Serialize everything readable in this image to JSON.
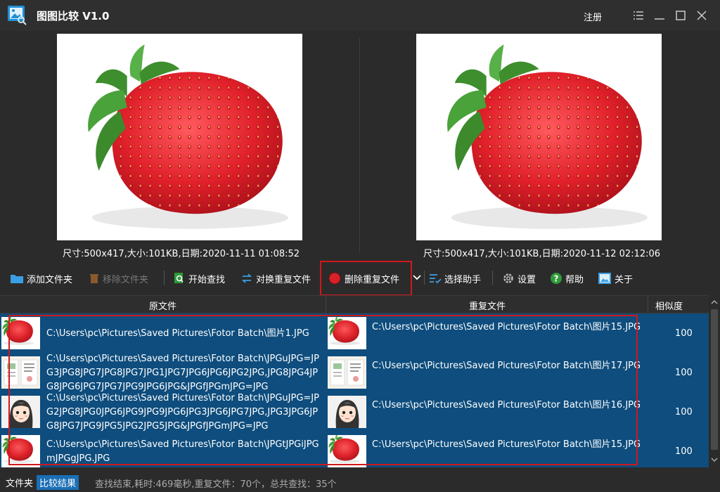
{
  "app": {
    "title": "图图比较 V1.0",
    "register_label": "注册"
  },
  "preview": {
    "left_caption": "尺寸:500x417,大小:101KB,日期:2020-11-11 01:08:52",
    "right_caption": "尺寸:500x417,大小:101KB,日期:2020-11-12 02:12:06"
  },
  "toolbar": {
    "add_folder": "添加文件夹",
    "remove_folder": "移除文件夹",
    "start_search": "开始查找",
    "swap_duplicates": "对换重复文件",
    "delete_duplicates": "删除重复文件",
    "select_helper": "选择助手",
    "settings": "设置",
    "help": "帮助",
    "about": "关于"
  },
  "table": {
    "headers": {
      "original": "原文件",
      "duplicate": "重复文件",
      "similarity": "相似度"
    },
    "rows": [
      {
        "original": "C:\\Users\\pc\\Pictures\\Saved Pictures\\Fotor Batch\\图片1.JPG",
        "duplicate": "C:\\Users\\pc\\Pictures\\Saved Pictures\\Fotor Batch\\图片15.JPG",
        "similarity": "100",
        "thumb_left": "strawberry",
        "thumb_right": "strawberry"
      },
      {
        "original": "C:\\Users\\pc\\Pictures\\Saved Pictures\\Fotor Batch\\JPGuJPG=JPG3JPG8JPG7JPG8JPG7JPG1JPG7JPG6JPG6JPG2JPG,JPG8JPG4JPG8JPG6JPG7JPG7JPG9JPG6JPG&JPGfJPGmJPG=JPG",
        "duplicate": "C:\\Users\\pc\\Pictures\\Saved Pictures\\Fotor Batch\\图片17.JPG",
        "similarity": "100",
        "thumb_left": "document",
        "thumb_right": "document"
      },
      {
        "original": "C:\\Users\\pc\\Pictures\\Saved Pictures\\Fotor Batch\\JPGuJPG=JPG2JPG8JPG0JPG6JPG9JPG9JPG6JPG3JPG6JPG7JPG,JPG3JPG6JPG8JPG7JPG9JPG5JPG2JPG5JPG&JPGfJPGmJPG=JPG",
        "duplicate": "C:\\Users\\pc\\Pictures\\Saved Pictures\\Fotor Batch\\图片16.JPG",
        "similarity": "100",
        "thumb_left": "cartoon-girl",
        "thumb_right": "cartoon-girl"
      },
      {
        "original": "C:\\Users\\pc\\Pictures\\Saved Pictures\\Fotor Batch\\JPGtJPGiJPGmJPGgJPG.JPG",
        "duplicate": "C:\\Users\\pc\\Pictures\\Saved Pictures\\Fotor Batch\\图片15.JPG",
        "similarity": "100",
        "thumb_left": "strawberry",
        "thumb_right": "strawberry"
      }
    ]
  },
  "status": {
    "tab_folder": "文件夹",
    "tab_results": "比较结果",
    "message": "查找结束,耗时:469毫秒,重复文件：70个，总共查找：35个"
  },
  "colors": {
    "highlight": "#d0181c",
    "selection": "#0e4d7d",
    "accent": "#1a6fb5"
  }
}
